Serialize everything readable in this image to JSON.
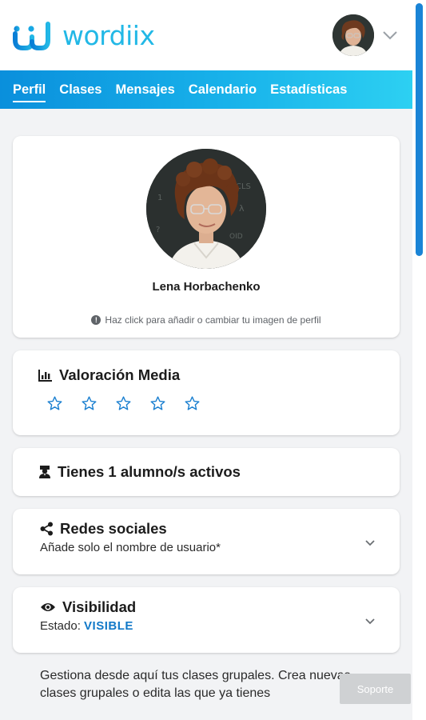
{
  "header": {
    "brand": "wordiix",
    "logo_icon": "wordiix-logo-icon",
    "avatar_icon": "user-avatar",
    "menu_icon": "chevron-down-icon"
  },
  "nav": {
    "items": [
      {
        "label": "Perfil",
        "active": true
      },
      {
        "label": "Clases",
        "active": false
      },
      {
        "label": "Mensajes",
        "active": false
      },
      {
        "label": "Calendario",
        "active": false
      },
      {
        "label": "Estadísticas",
        "active": false
      }
    ]
  },
  "profile": {
    "name": "Lena Horbachenko",
    "hint": "Haz click para añadir o cambiar tu imagen de perfil"
  },
  "rating": {
    "title": "Valoración Media",
    "icon": "bar-chart-icon",
    "stars_filled": 0,
    "stars_total": 5
  },
  "students": {
    "label": "Tienes 1 alumno/s activos",
    "icon": "graduate-icon"
  },
  "social": {
    "title": "Redes sociales",
    "subtitle": "Añade solo el nombre de usuario*",
    "icon": "share-icon"
  },
  "visibility": {
    "title": "Visibilidad",
    "status_label": "Estado:",
    "status_value": "VISIBLE",
    "icon": "eye-icon"
  },
  "description": "Gestiona desde aquí tus clases grupales. Crea nuevas clases grupales o edita las que ya tienes",
  "support_button": "Soporte",
  "colors": {
    "brand": "#22b8e6",
    "nav_start": "#0a8fdc",
    "nav_end": "#2dd0f2",
    "accent": "#1279c8",
    "scrollbar": "#1a84d6"
  }
}
